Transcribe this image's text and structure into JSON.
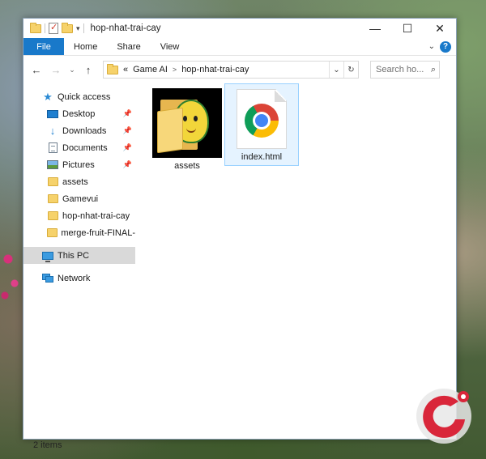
{
  "window": {
    "title": "hop-nhat-trai-cay",
    "minimize": "—",
    "maximize": "☐",
    "close": "✕"
  },
  "ribbon": {
    "tabs": [
      "File",
      "Home",
      "Share",
      "View"
    ],
    "help": "?"
  },
  "address": {
    "overflow": "«",
    "crumbs": [
      "Game AI",
      "hop-nhat-trai-cay"
    ],
    "refresh_icon": "refresh-icon"
  },
  "search": {
    "placeholder": "Search ho..."
  },
  "nav_pane": {
    "quick_access": "Quick access",
    "pinned": [
      {
        "label": "Desktop",
        "icon": "desktop-icon"
      },
      {
        "label": "Downloads",
        "icon": "downloads-icon"
      },
      {
        "label": "Documents",
        "icon": "documents-icon"
      },
      {
        "label": "Pictures",
        "icon": "pictures-icon"
      }
    ],
    "folders": [
      "assets",
      "Gamevui",
      "hop-nhat-trai-cay",
      "merge-fruit-FINAL-"
    ],
    "this_pc": "This PC",
    "network": "Network"
  },
  "content": {
    "items": [
      {
        "name": "assets",
        "type": "folder"
      },
      {
        "name": "index.html",
        "type": "chrome-html-file"
      }
    ]
  },
  "status": {
    "count": "2 items"
  },
  "colors": {
    "accent": "#1979ca",
    "selected_bg": "#e5f3ff",
    "selected_border": "#99d1ff",
    "nav_selected": "#d9d9d9"
  }
}
